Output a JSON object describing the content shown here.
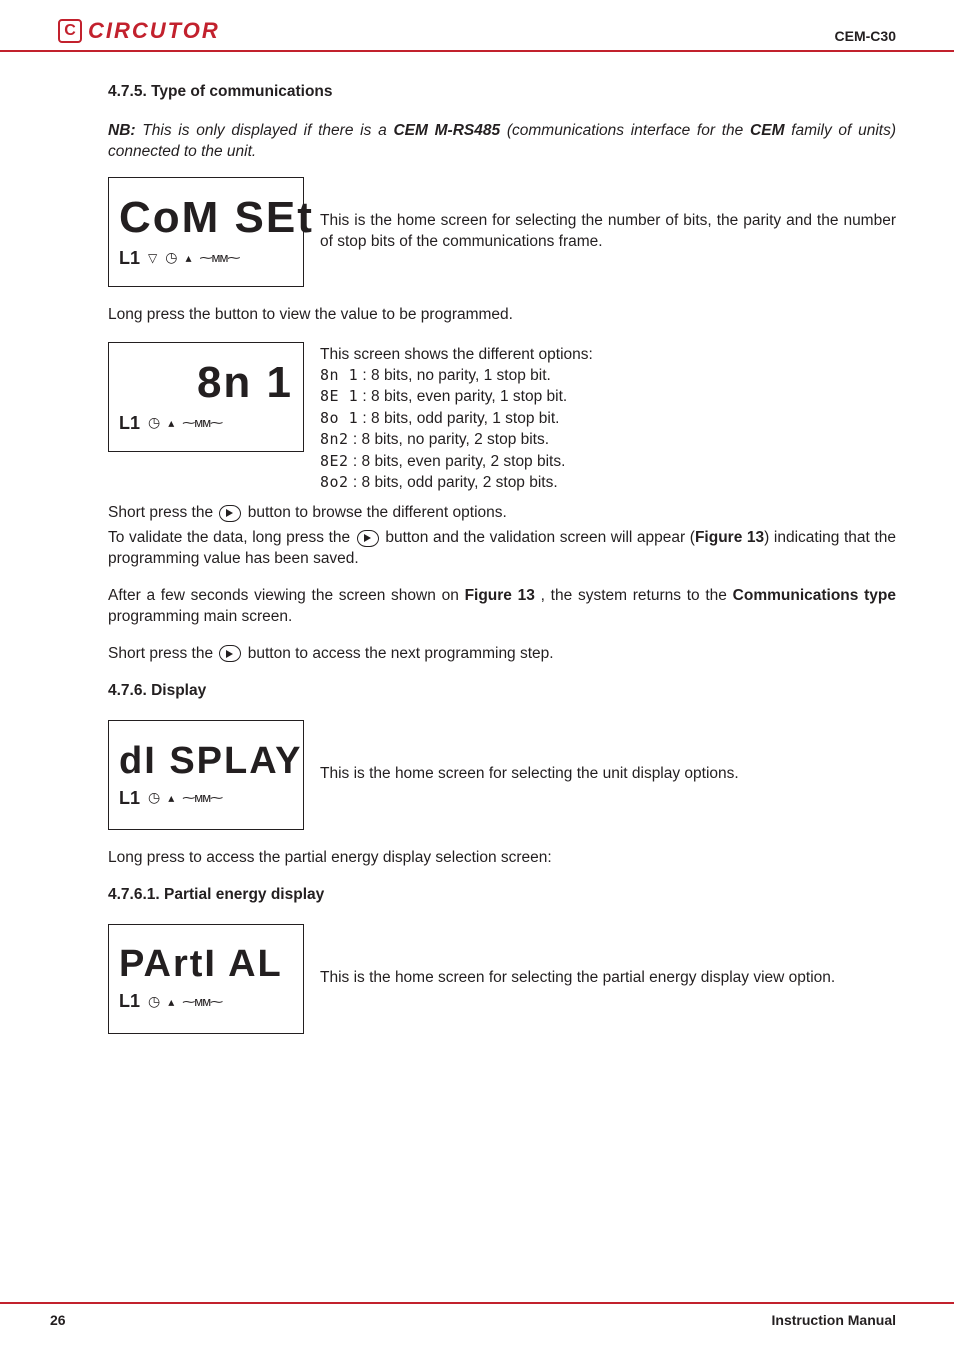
{
  "header": {
    "brand": "CIRCUTOR",
    "model": "CEM-C30"
  },
  "sec475": {
    "heading": "4.7.5. Type of communications",
    "nb_label": "NB:",
    "nb_text_1": " This is only displayed if there is a ",
    "nb_cem1": "CEM M-RS485",
    "nb_text_2": " (communications interface for the ",
    "nb_cem2": "CEM",
    "nb_text_3": " family of units) connected to the unit.",
    "screen1_main": "CoM  SEt",
    "l1": "L1",
    "screen1_desc": "This is the home screen for selecting the number of bits, the parity and the number of stop bits of the communications frame.",
    "longpress1": "Long press the button to view the value to be programmed.",
    "screen2_main": "8n 1",
    "opts_intro": "This screen shows the different options:",
    "opts": [
      {
        "code": "8n 1",
        "desc": " : 8 bits, no parity, 1 stop bit."
      },
      {
        "code": "8E 1",
        "desc": " : 8 bits, even parity, 1 stop bit."
      },
      {
        "code": "8o 1",
        "desc": " : 8 bits, odd parity, 1 stop bit."
      },
      {
        "code": "8n2",
        "desc": " : 8 bits, no parity, 2 stop bits."
      },
      {
        "code": "8E2",
        "desc": " : 8 bits, even parity, 2 stop bits."
      },
      {
        "code": "8o2",
        "desc": " : 8 bits, odd parity, 2 stop bits."
      }
    ],
    "short_browse_a": "Short press the ",
    "short_browse_b": " button to browse the different options.",
    "validate_a": "To validate the data, long press the ",
    "validate_b": " button and the validation screen will appear (",
    "validate_fig": "Figure 13",
    "validate_c": ") indicating that the programming value has been saved.",
    "after_a": "After a few seconds viewing the screen shown on ",
    "after_fig": "Figure 13",
    "after_b": " , the system returns to the ",
    "after_ctype": "Communications type",
    "after_c": " programming main screen.",
    "short_next_a": "Short press the ",
    "short_next_b": " button to access the next programming step."
  },
  "sec476": {
    "heading": "4.7.6. Display",
    "screen_main": "dI SPLAY",
    "desc": "This is the home screen for selecting the unit display options.",
    "longpress": "Long press to access the partial energy display selection screen:"
  },
  "sec4761": {
    "heading": "4.7.6.1. Partial energy display",
    "screen_main": "PArtI AL",
    "desc": "This is the home screen for selecting the partial energy display view option."
  },
  "footer": {
    "page": "26",
    "label": "Instruction Manual"
  }
}
